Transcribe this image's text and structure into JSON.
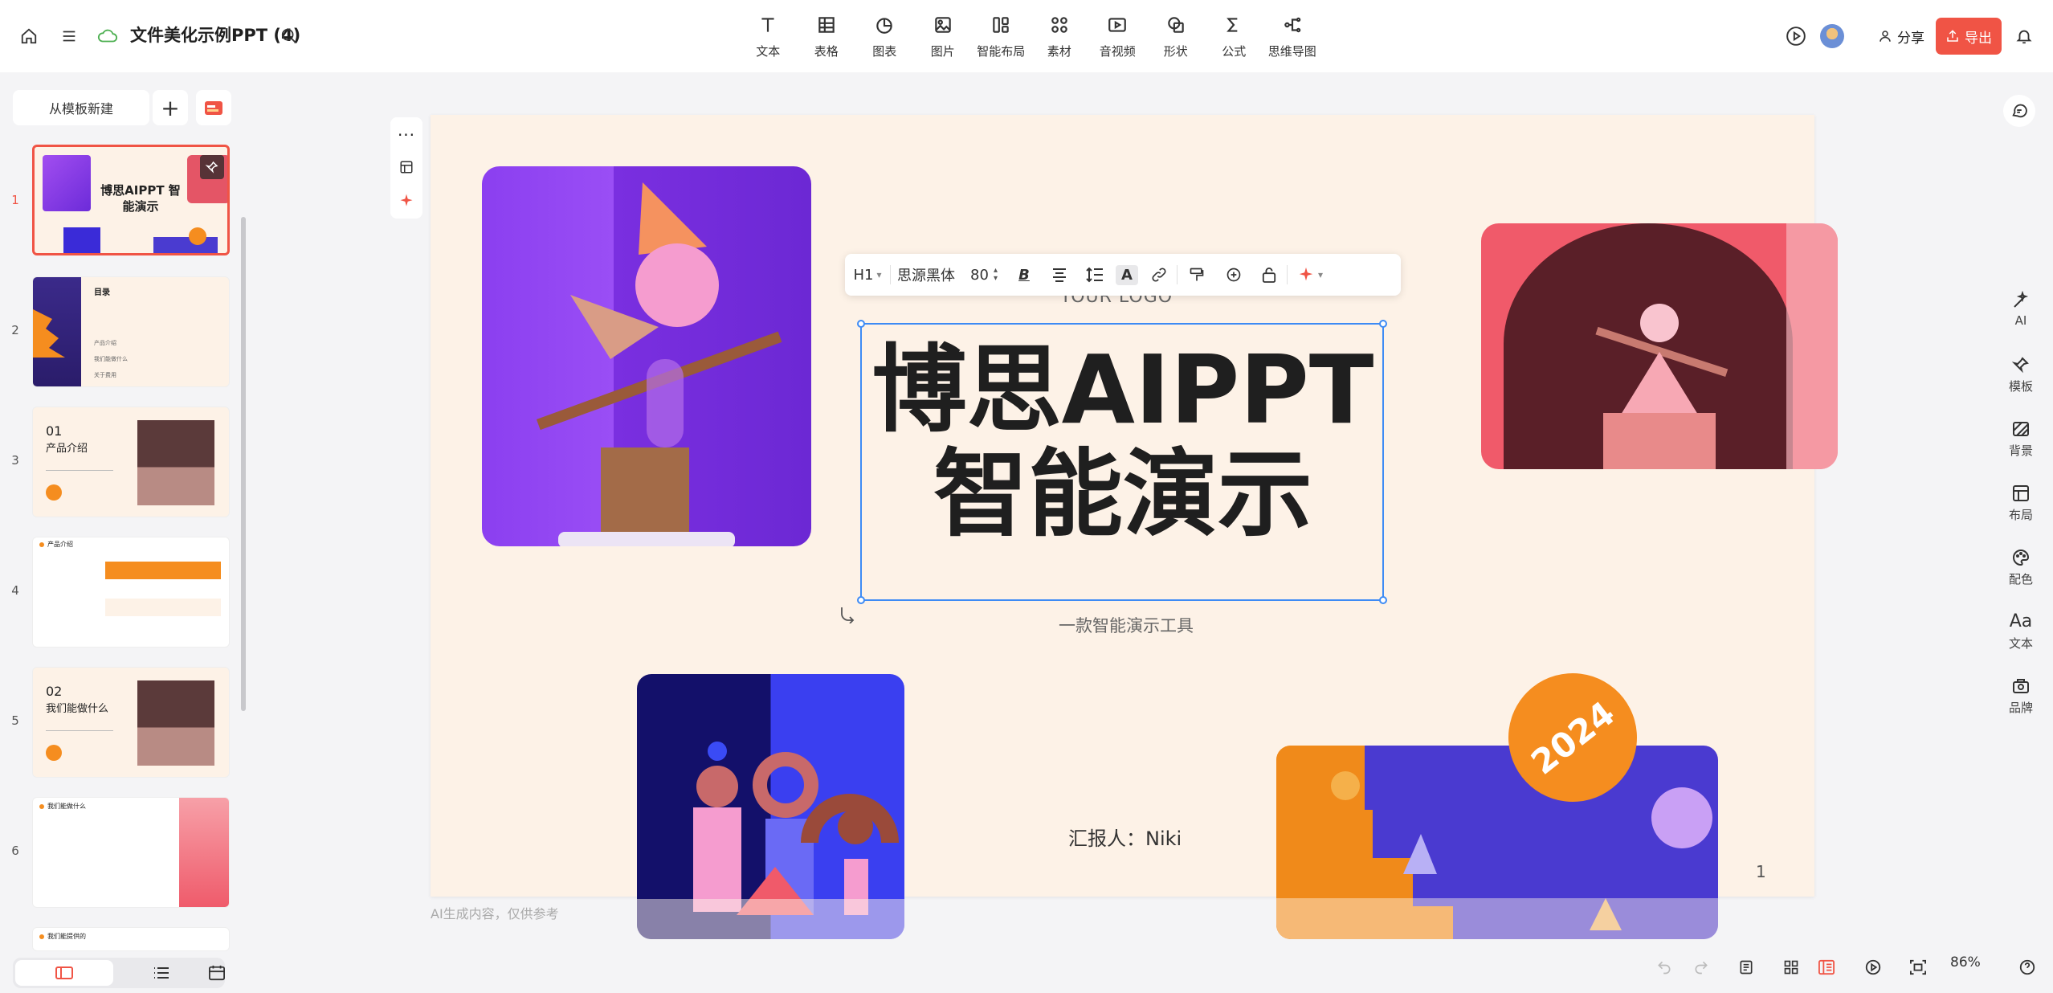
{
  "header": {
    "doc_title": "文件美化示例PPT (4)",
    "tools": [
      {
        "label": "文本",
        "icon": "text-icon"
      },
      {
        "label": "表格",
        "icon": "table-icon"
      },
      {
        "label": "图表",
        "icon": "chart-icon"
      },
      {
        "label": "图片",
        "icon": "image-icon"
      },
      {
        "label": "智能布局",
        "icon": "smart-layout-icon"
      },
      {
        "label": "素材",
        "icon": "material-icon"
      },
      {
        "label": "音视频",
        "icon": "video-icon"
      },
      {
        "label": "形状",
        "icon": "shape-icon"
      },
      {
        "label": "公式",
        "icon": "formula-icon"
      },
      {
        "label": "思维导图",
        "icon": "mindmap-icon"
      }
    ],
    "share_label": "分享",
    "export_label": "导出",
    "colors": {
      "export": "#f05445",
      "accent": "#f58d1f"
    }
  },
  "sidebar": {
    "template_button": "从模板新建",
    "slides": [
      {
        "num": "1",
        "title": "博思AIPPT 智能演示"
      },
      {
        "num": "2",
        "title": "目录",
        "items": [
          "产品介绍",
          "我们能做什么",
          "关于费用"
        ]
      },
      {
        "num": "3",
        "title": "01",
        "subtitle": "产品介绍"
      },
      {
        "num": "4",
        "title": "产品介绍"
      },
      {
        "num": "5",
        "title": "02",
        "subtitle": "我们能做什么"
      },
      {
        "num": "6",
        "title": "我们能做什么"
      },
      {
        "num": "7",
        "title": "我们能提供的"
      }
    ]
  },
  "text_toolbar": {
    "heading": "H1",
    "font": "思源黑体",
    "size": "80"
  },
  "slide": {
    "logo": "YOUR LOGO",
    "title_line1": "博思AIPPT",
    "title_line2": "智能演示",
    "subtitle": "一款智能演示工具",
    "reporter": "汇报人：Niki",
    "page_number": "1",
    "badge_year": "2024"
  },
  "canvas": {
    "ai_note": "AI生成内容，仅供参考"
  },
  "right_rail": [
    {
      "label": "AI",
      "icon": "ai-magic-icon"
    },
    {
      "label": "模板",
      "icon": "template-icon"
    },
    {
      "label": "背景",
      "icon": "background-icon"
    },
    {
      "label": "布局",
      "icon": "layout-icon"
    },
    {
      "label": "配色",
      "icon": "palette-icon"
    },
    {
      "label": "文本",
      "icon": "text-style-icon",
      "glyph": "Aa"
    },
    {
      "label": "品牌",
      "icon": "brand-icon"
    }
  ],
  "footer": {
    "zoom": "86%"
  }
}
